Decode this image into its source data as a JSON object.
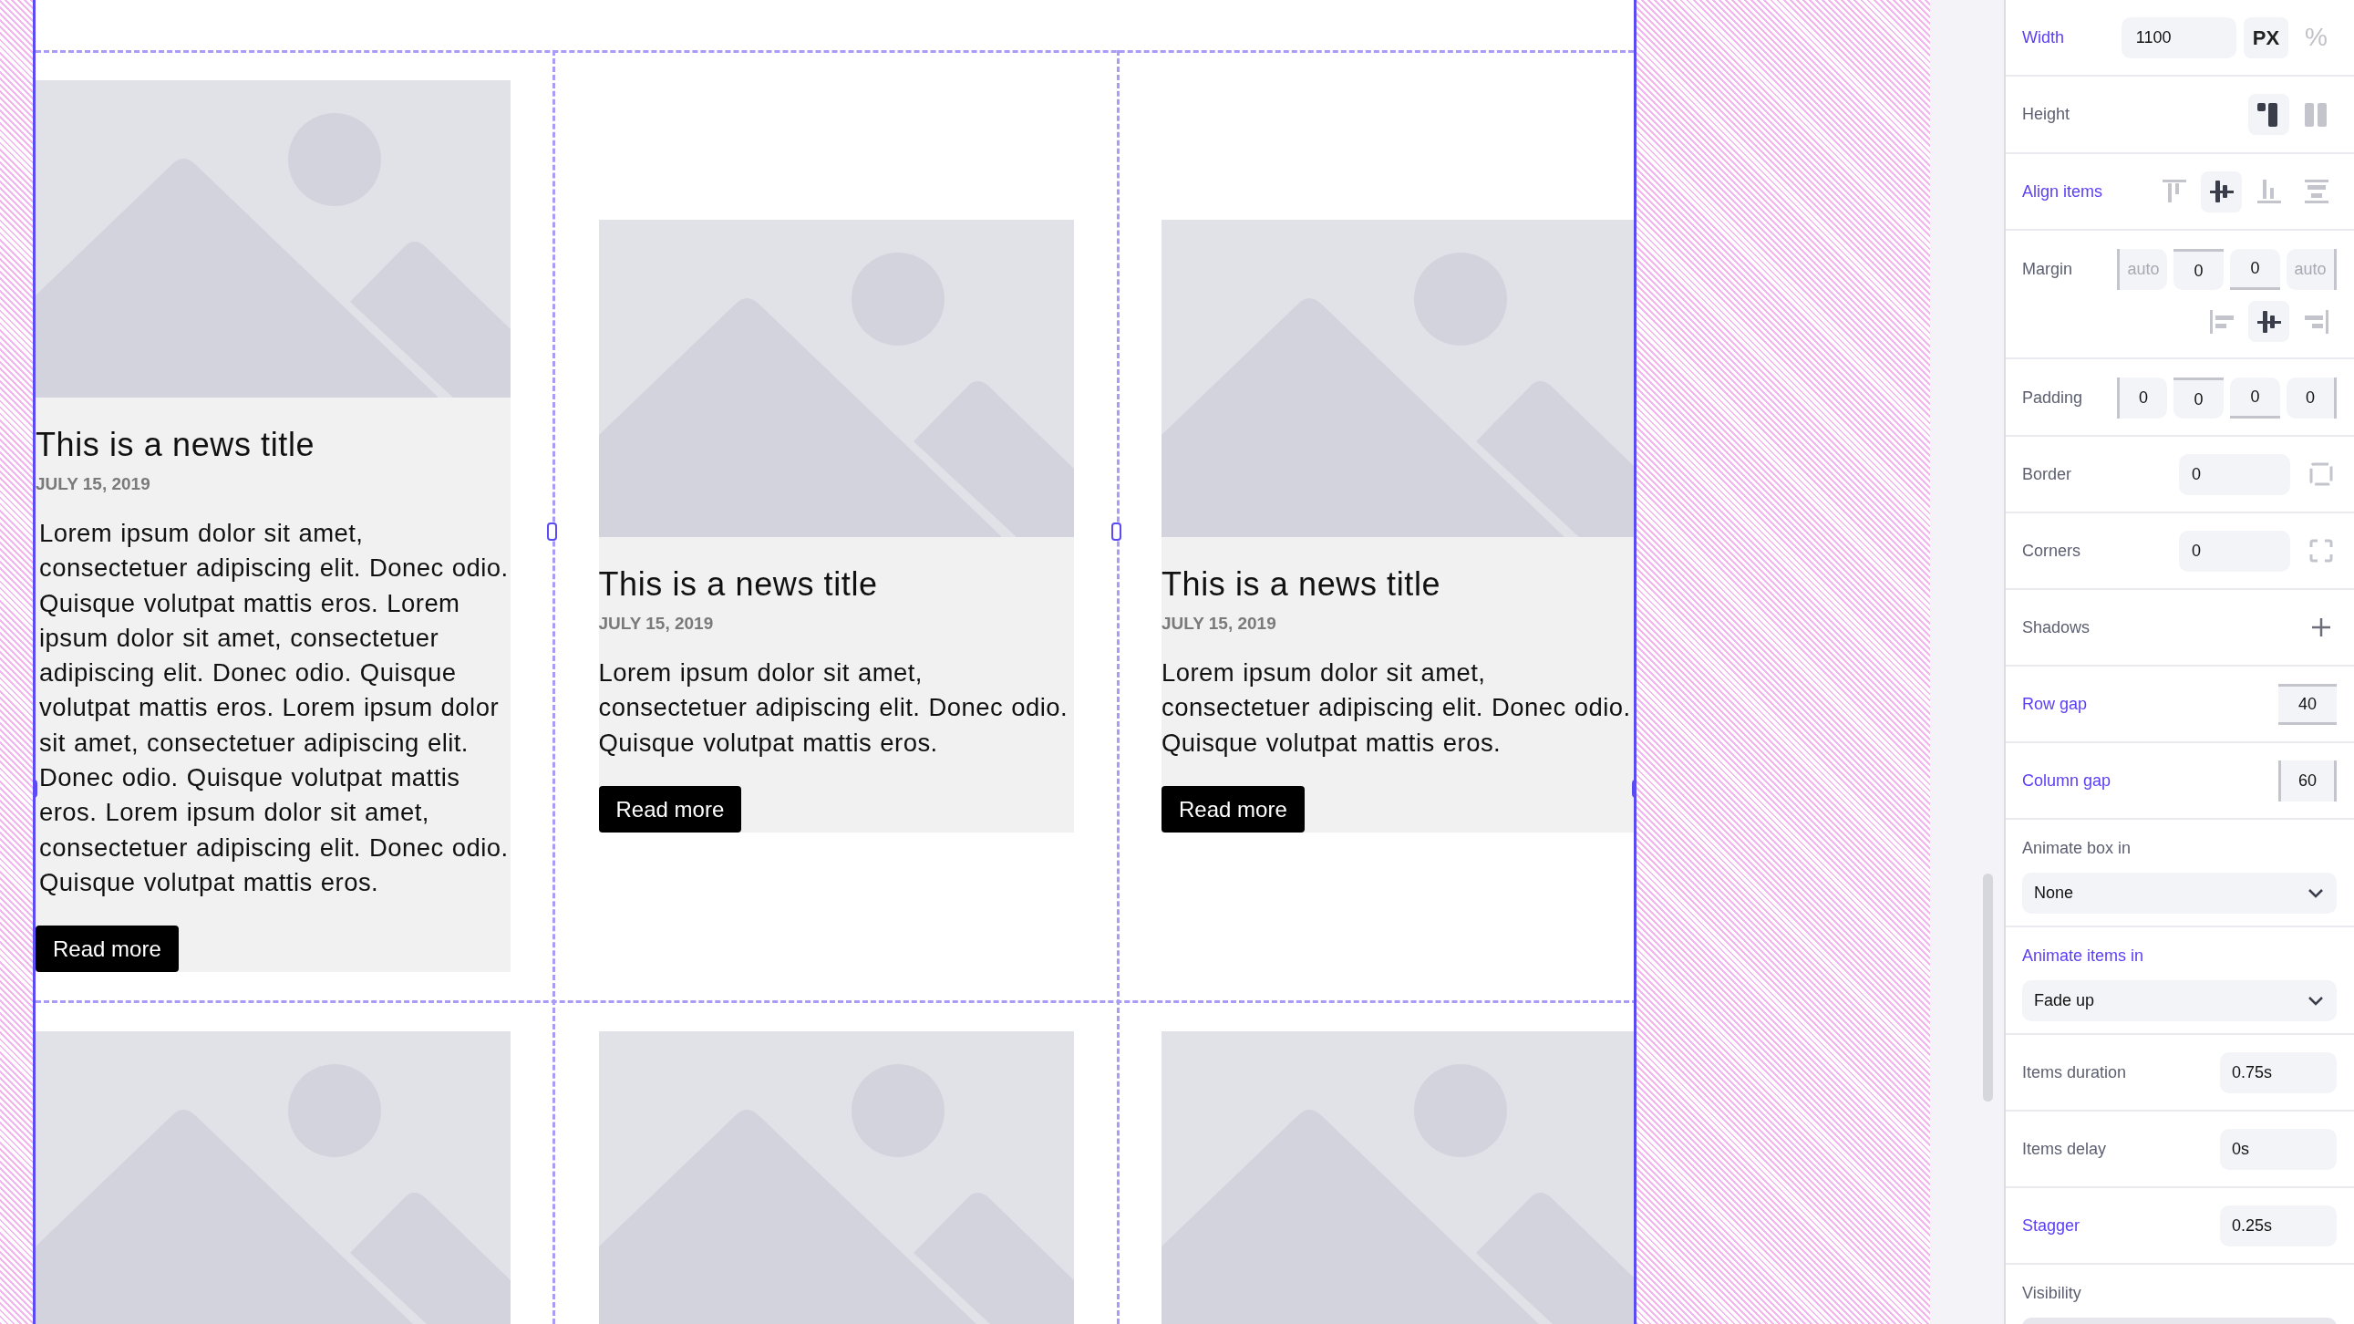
{
  "canvas": {
    "cards": [
      {
        "kind": "article",
        "title": "This is a news title",
        "date": "JULY 15, 2019",
        "text": "Lorem ipsum dolor sit amet, consectetuer adipiscing elit. Donec odio. Quisque volutpat mattis eros. Lorem ipsum dolor sit amet, consectetuer adipiscing elit. Donec odio. Quisque volutpat mattis eros. Lorem ipsum dolor sit amet, consectetuer adipiscing elit. Donec odio. Quisque volutpat mattis eros. Lorem ipsum dolor sit amet, consectetuer adipiscing elit. Donec odio. Quisque volutpat mattis eros.",
        "button": "Read more"
      },
      {
        "kind": "article",
        "title": "This is a news title",
        "date": "JULY 15, 2019",
        "text": "Lorem ipsum dolor sit amet, consectetuer adipiscing elit. Donec odio. Quisque volutpat mattis eros.",
        "button": "Read more"
      },
      {
        "kind": "article",
        "title": "This is a news title",
        "date": "JULY 15, 2019",
        "text": "Lorem ipsum dolor sit amet, consectetuer adipiscing elit. Donec odio. Quisque volutpat mattis eros.",
        "button": "Read more"
      },
      {
        "kind": "image_only"
      },
      {
        "kind": "image_only"
      },
      {
        "kind": "image_only"
      }
    ]
  },
  "properties": [
    {
      "kind": "unit_input",
      "label": "Width",
      "modified": true,
      "value": "1100",
      "units": [
        {
          "label": "PX",
          "selected": true
        },
        {
          "label": "%",
          "selected": false
        }
      ]
    },
    {
      "kind": "icon_toggles",
      "label": "Height",
      "modified": false,
      "options": [
        {
          "kind": "fit",
          "selected": true
        },
        {
          "kind": "fill",
          "selected": false
        }
      ]
    },
    {
      "kind": "icon_toggles",
      "label": "Align items",
      "modified": true,
      "options": [
        {
          "kind": "top",
          "selected": false
        },
        {
          "kind": "center",
          "selected": true
        },
        {
          "kind": "bottom",
          "selected": false
        },
        {
          "kind": "stretch",
          "selected": false
        }
      ]
    },
    {
      "kind": "sides",
      "label": "Margin",
      "modified": false,
      "fields": [
        {
          "placeholder": "auto"
        },
        {
          "value": "0"
        },
        {
          "value": "0"
        },
        {
          "placeholder": "auto"
        }
      ],
      "align": [
        {
          "kind": "left",
          "selected": false
        },
        {
          "kind": "center",
          "selected": true
        },
        {
          "kind": "right",
          "selected": false
        }
      ]
    },
    {
      "kind": "sides",
      "label": "Padding",
      "modified": false,
      "fields": [
        {
          "value": "0"
        },
        {
          "value": "0"
        },
        {
          "value": "0"
        },
        {
          "value": "0"
        }
      ]
    },
    {
      "kind": "border_input",
      "label": "Border",
      "modified": false,
      "value": "0"
    },
    {
      "kind": "corners_input",
      "label": "Corners",
      "modified": false,
      "value": "0"
    },
    {
      "kind": "add",
      "label": "Shadows",
      "modified": false
    },
    {
      "kind": "row_gap",
      "label": "Row gap",
      "modified": true,
      "value": "40"
    },
    {
      "kind": "column_gap",
      "label": "Column gap",
      "modified": true,
      "value": "60"
    },
    {
      "kind": "select",
      "label": "Animate box in",
      "modified": false,
      "value": "None"
    },
    {
      "kind": "select",
      "label": "Animate items in",
      "modified": true,
      "value": "Fade up"
    },
    {
      "kind": "input",
      "label": "Items duration",
      "modified": false,
      "value": "0.75s"
    },
    {
      "kind": "input",
      "label": "Items delay",
      "modified": false,
      "value": "0s"
    },
    {
      "kind": "input",
      "label": "Stagger",
      "modified": true,
      "value": "0.25s"
    },
    {
      "kind": "select",
      "label": "Visibility",
      "modified": false
    }
  ]
}
